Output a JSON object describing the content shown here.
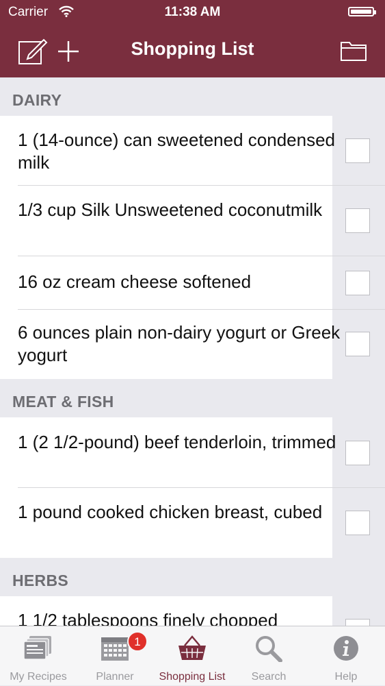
{
  "status_bar": {
    "carrier": "Carrier",
    "time": "11:38 AM"
  },
  "nav": {
    "title": "Shopping List",
    "icons": [
      "edit-icon",
      "add-icon",
      "folder-icon"
    ]
  },
  "sections": [
    {
      "title": "DAIRY",
      "items": [
        {
          "text": "1 (14-ounce) can sweetened condensed milk",
          "checked": false
        },
        {
          "text": "1/3 cup Silk Unsweetened coconutmilk",
          "checked": false
        },
        {
          "text": "16 oz cream cheese softened",
          "checked": false
        },
        {
          "text": "6 ounces plain non-dairy yogurt or Greek yogurt",
          "checked": false
        }
      ]
    },
    {
      "title": "MEAT & FISH",
      "items": [
        {
          "text": "1 (2 1/2-pound) beef tenderloin, trimmed",
          "checked": false
        },
        {
          "text": "1 pound cooked chicken breast, cubed",
          "checked": false
        }
      ]
    },
    {
      "title": "HERBS",
      "items": [
        {
          "text": "1 1/2 tablespoons finely chopped",
          "checked": false
        }
      ]
    }
  ],
  "tabbar": {
    "tabs": [
      {
        "label": "My Recipes",
        "icon": "recipes-icon",
        "active": false
      },
      {
        "label": "Planner",
        "icon": "calendar-icon",
        "active": false
      },
      {
        "label": "Shopping List",
        "icon": "basket-icon",
        "active": true
      },
      {
        "label": "Search",
        "icon": "search-icon",
        "active": false
      },
      {
        "label": "Help",
        "icon": "info-icon",
        "active": false
      }
    ],
    "planner_badge": "1"
  },
  "colors": {
    "brand": "#7a2e3e",
    "badge": "#e0302a"
  }
}
